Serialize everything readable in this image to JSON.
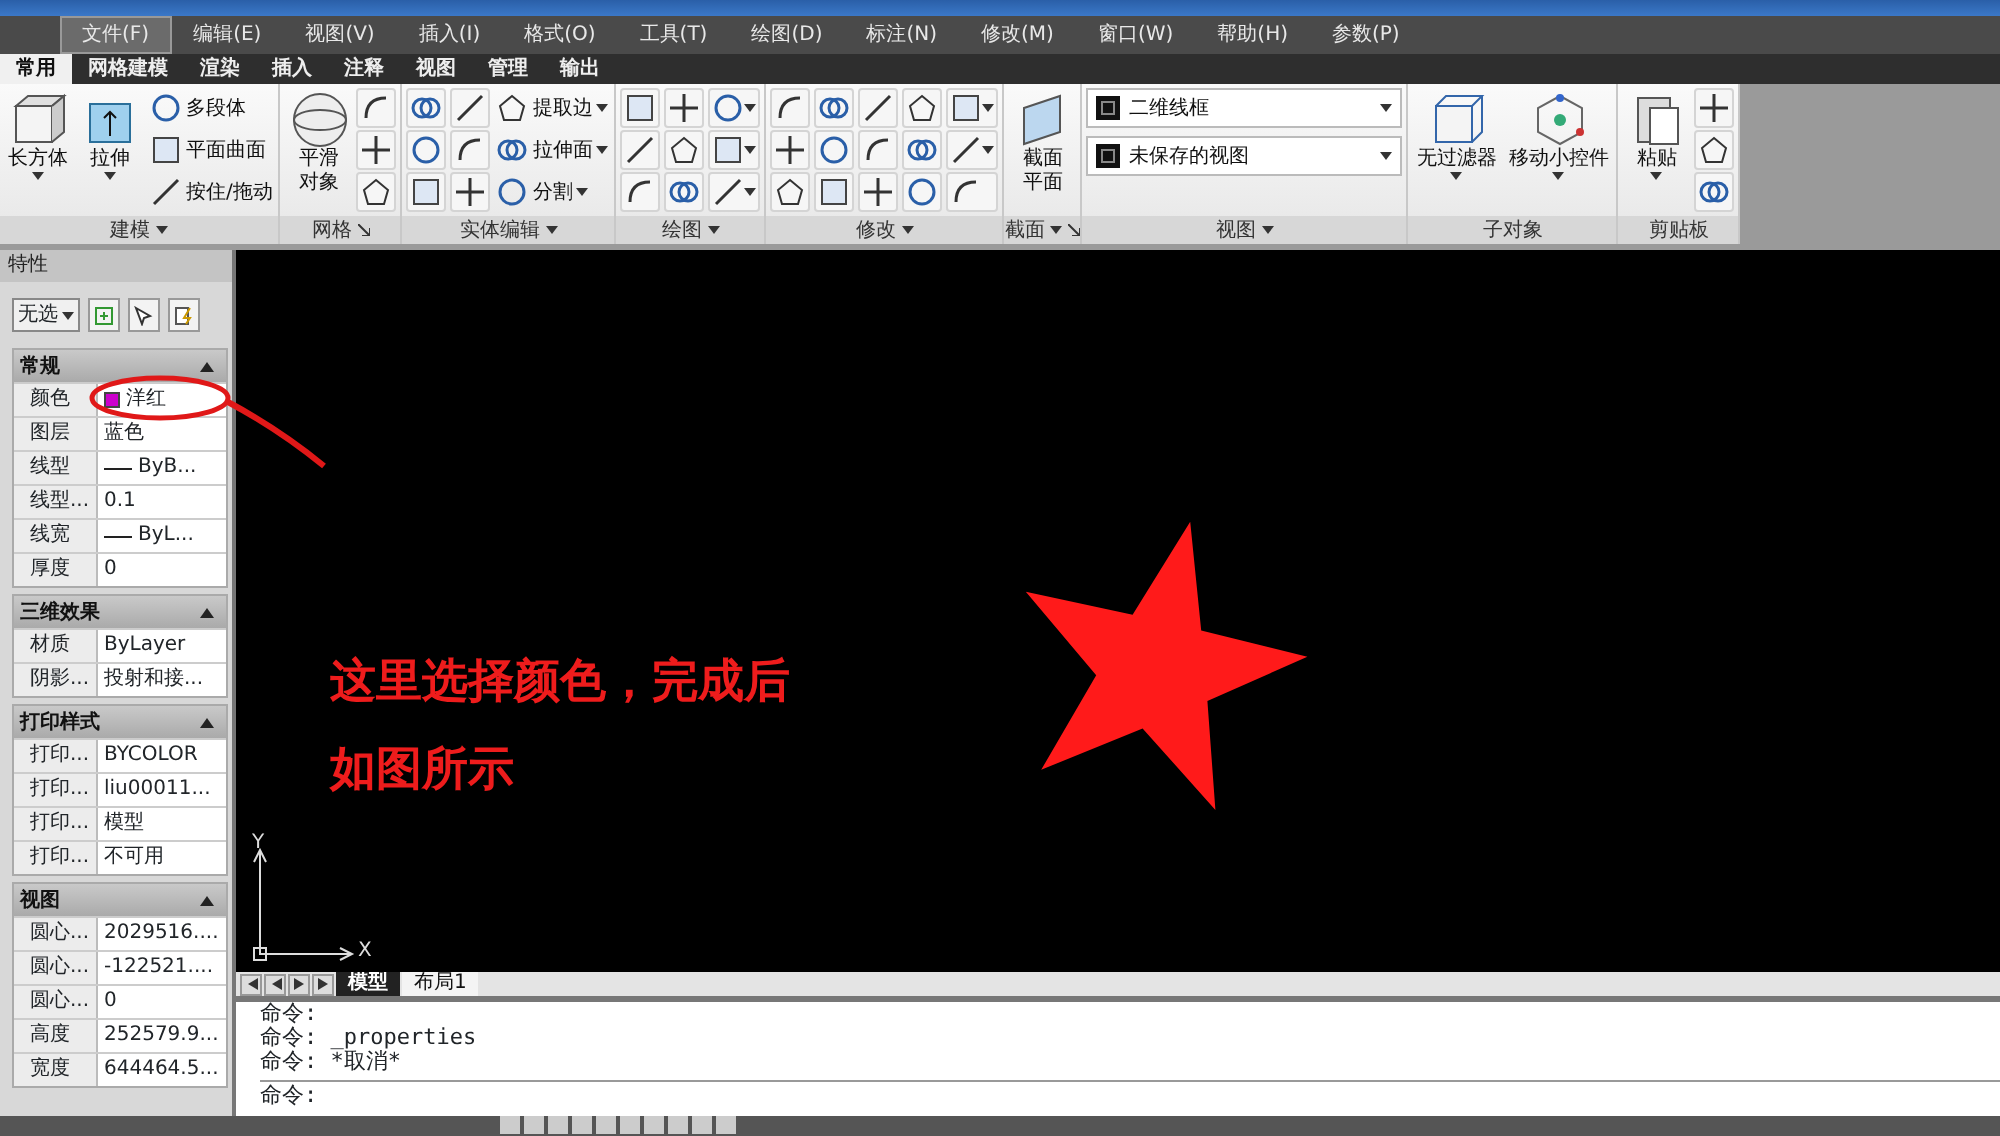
{
  "menu": [
    {
      "label": "文件(F)",
      "selected": true
    },
    {
      "label": "编辑(E)",
      "selected": false
    },
    {
      "label": "视图(V)",
      "selected": false
    },
    {
      "label": "插入(I)",
      "selected": false
    },
    {
      "label": "格式(O)",
      "selected": false
    },
    {
      "label": "工具(T)",
      "selected": false
    },
    {
      "label": "绘图(D)",
      "selected": false
    },
    {
      "label": "标注(N)",
      "selected": false
    },
    {
      "label": "修改(M)",
      "selected": false
    },
    {
      "label": "窗口(W)",
      "selected": false
    },
    {
      "label": "帮助(H)",
      "selected": false
    },
    {
      "label": "参数(P)",
      "selected": false
    }
  ],
  "ribbon_tabs": [
    {
      "label": "常用",
      "selected": true
    },
    {
      "label": "网格建模",
      "selected": false
    },
    {
      "label": "渲染",
      "selected": false
    },
    {
      "label": "插入",
      "selected": false
    },
    {
      "label": "注释",
      "selected": false
    },
    {
      "label": "视图",
      "selected": false
    },
    {
      "label": "管理",
      "selected": false
    },
    {
      "label": "输出",
      "selected": false
    }
  ],
  "ribbon_panels": [
    {
      "title": "建模",
      "menu": true,
      "tools": [
        {
          "kind": "large",
          "label": "长方体",
          "menu": true
        },
        {
          "kind": "large",
          "label": "拉伸",
          "menu": true
        },
        {
          "kind": "small",
          "label": "多段体"
        },
        {
          "kind": "small",
          "label": "平面曲面"
        },
        {
          "kind": "small",
          "label": "按住/拖动"
        }
      ]
    },
    {
      "title": "网格",
      "launcher": true,
      "tools": [
        {
          "kind": "large",
          "label": "平滑对象"
        },
        {
          "kind": "icon"
        },
        {
          "kind": "icon"
        },
        {
          "kind": "icon"
        }
      ]
    },
    {
      "title": "实体编辑",
      "menu": true,
      "tools": [
        {
          "kind": "icon"
        },
        {
          "kind": "icon"
        },
        {
          "kind": "icon"
        },
        {
          "kind": "icon"
        },
        {
          "kind": "icon"
        },
        {
          "kind": "icon"
        },
        {
          "kind": "small",
          "label": "提取边",
          "menu": true
        },
        {
          "kind": "small",
          "label": "拉伸面",
          "menu": true
        },
        {
          "kind": "small",
          "label": "分割",
          "menu": true
        }
      ]
    },
    {
      "title": "绘图",
      "menu": true,
      "tools": [
        {
          "kind": "icon"
        },
        {
          "kind": "icon"
        },
        {
          "kind": "icon"
        },
        {
          "kind": "icon"
        },
        {
          "kind": "icon"
        },
        {
          "kind": "icon"
        },
        {
          "kind": "icon",
          "menu": true
        },
        {
          "kind": "icon",
          "menu": true
        },
        {
          "kind": "icon",
          "menu": true
        }
      ]
    },
    {
      "title": "修改",
      "menu": true,
      "tools": [
        {
          "kind": "icon"
        },
        {
          "kind": "icon"
        },
        {
          "kind": "icon"
        },
        {
          "kind": "icon"
        },
        {
          "kind": "icon"
        },
        {
          "kind": "icon"
        },
        {
          "kind": "icon"
        },
        {
          "kind": "icon"
        },
        {
          "kind": "icon"
        },
        {
          "kind": "icon"
        },
        {
          "kind": "icon"
        },
        {
          "kind": "icon"
        },
        {
          "kind": "icon",
          "menu": true
        },
        {
          "kind": "icon",
          "menu": true
        },
        {
          "kind": "icon"
        }
      ]
    },
    {
      "title": "截面",
      "menu": true,
      "launcher": true,
      "tools": [
        {
          "kind": "large",
          "label": "截面平面"
        }
      ]
    },
    {
      "title": "视图",
      "menu": true,
      "tools": [
        {
          "kind": "dropdown",
          "label": "二维线框",
          "menu": true
        },
        {
          "kind": "dropdown",
          "label": "未保存的视图",
          "menu": true
        }
      ]
    },
    {
      "title": "子对象",
      "tools": [
        {
          "kind": "large",
          "label": "无过滤器",
          "menu": true
        },
        {
          "kind": "large",
          "label": "移动小控件",
          "menu": true
        }
      ]
    },
    {
      "title": "剪贴板",
      "tools": [
        {
          "kind": "large",
          "label": "粘贴",
          "menu": true
        },
        {
          "kind": "icon"
        },
        {
          "kind": "icon"
        },
        {
          "kind": "icon"
        }
      ]
    }
  ],
  "properties": {
    "title": "特性",
    "selection": "无选",
    "sections": [
      {
        "title": "常规",
        "expanded": true,
        "rows": [
          {
            "label": "颜色",
            "value": "洋红",
            "color": "#cc00cc"
          },
          {
            "label": "图层",
            "value": "蓝色"
          },
          {
            "label": "线型",
            "value": "ByB...",
            "line_sample": true
          },
          {
            "label": "线型...",
            "value": "0.1"
          },
          {
            "label": "线宽",
            "value": "ByL...",
            "line_sample": true
          },
          {
            "label": "厚度",
            "value": "0"
          }
        ]
      },
      {
        "title": "三维效果",
        "expanded": true,
        "rows": [
          {
            "label": "材质",
            "value": "ByLayer"
          },
          {
            "label": "阴影...",
            "value": "投射和接..."
          }
        ]
      },
      {
        "title": "打印样式",
        "expanded": true,
        "rows": [
          {
            "label": "打印...",
            "value": "BYCOLOR"
          },
          {
            "label": "打印...",
            "value": "liu00011..."
          },
          {
            "label": "打印...",
            "value": "模型"
          },
          {
            "label": "打印...",
            "value": "不可用"
          }
        ]
      },
      {
        "title": "视图",
        "expanded": true,
        "rows": [
          {
            "label": "圆心...",
            "value": "2029516...."
          },
          {
            "label": "圆心...",
            "value": "-122521...."
          },
          {
            "label": "圆心...",
            "value": "0"
          },
          {
            "label": "高度",
            "value": "252579.9..."
          },
          {
            "label": "宽度",
            "value": "644464.5..."
          }
        ]
      }
    ]
  },
  "canvas": {
    "axis_x": "X",
    "axis_y": "Y",
    "callout": "这里选择颜色，完成后如图所示"
  },
  "layout_tabs": [
    {
      "label": "模型",
      "selected": true
    },
    {
      "label": "布局1",
      "selected": false
    }
  ],
  "command": {
    "history": [
      "命令:",
      "命令: _properties",
      "命令: *取消*"
    ],
    "prompt": "命令:"
  }
}
